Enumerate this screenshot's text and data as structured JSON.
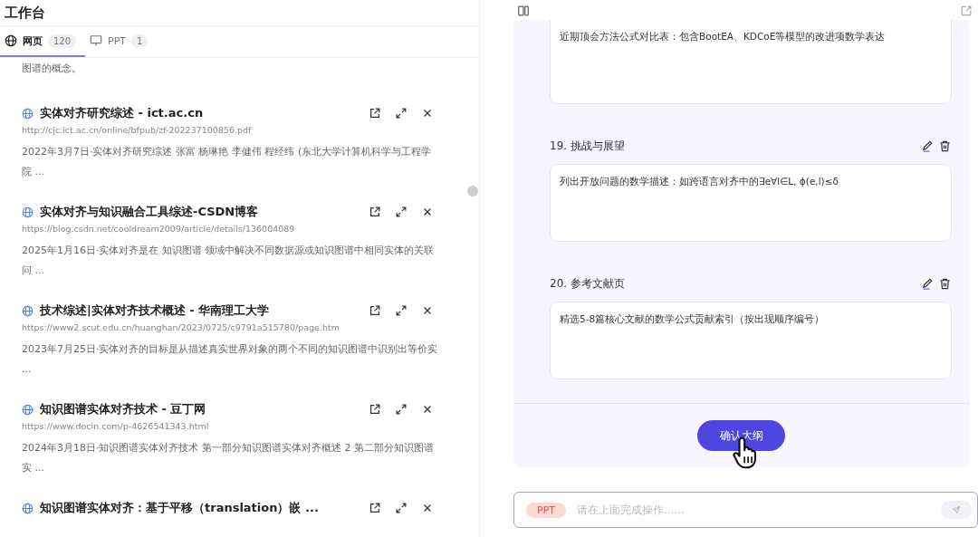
{
  "workspace": {
    "title": "工作台",
    "tabs": [
      {
        "kind": "web",
        "label": "网页",
        "count": "120",
        "selected": true
      },
      {
        "kind": "slides",
        "label": "PPT",
        "count": "1",
        "selected": false
      }
    ],
    "lead_text": "图谱的概念。",
    "results": [
      {
        "title": "实体对齐研究综述 - ict.ac.cn",
        "url": "http://cjc.ict.ac.cn/online/bfpub/zf-202237100856.pdf",
        "snippet": "2022年3月7日·实体对齐研究综述 张富 杨琳艳 李健伟 程经纬 (东北大学计算机科学与工程学院 ..."
      },
      {
        "title": "实体对齐与知识融合工具综述-CSDN博客",
        "url": "https://blog.csdn.net/cooldream2009/article/details/136004089",
        "snippet": "2025年1月16日·实体对齐是在 知识图谱 领域中解决不同数据源或知识图谱中相同实体的关联问 ..."
      },
      {
        "title": "技术综述|实体对齐技术概述 - 华南理工大学",
        "url": "https://www2.scut.edu.cn/huanghan/2023/0725/c9791a515780/page.htm",
        "snippet": "2023年7月25日·实体对齐的目标是从描述真实世界对象的两个不同的知识图谱中识别出等价实 ..."
      },
      {
        "title": "知识图谱实体对齐技术 - 豆丁网",
        "url": "https://www.docin.com/p-4626541343.html",
        "snippet": "2024年3月18日·知识图谱实体对齐技术 第一部分知识图谱实体对齐概述 2 第二部分知识图谱实 ..."
      },
      {
        "title": "知识图谱实体对齐：基于平移（translation）嵌 ..."
      }
    ]
  },
  "outline": {
    "sections": [
      {
        "text": "近期顶会方法公式对比表：包含BootEA、KDCoE等模型的改进项数学表达"
      },
      {
        "title": "19. 挑战与展望",
        "text": "列出开放问题的数学描述：如跨语言对齐中的∃e∀l∈L, ϕ(e,l)≤δ"
      },
      {
        "title": "20. 参考文献页",
        "text": "精选5-8篇核心文献的数学公式贡献索引（按出现顺序编号）"
      }
    ],
    "confirm_button": "确认大纲"
  },
  "composer": {
    "tag": "PPT",
    "placeholder": "请在上面完成操作......"
  }
}
